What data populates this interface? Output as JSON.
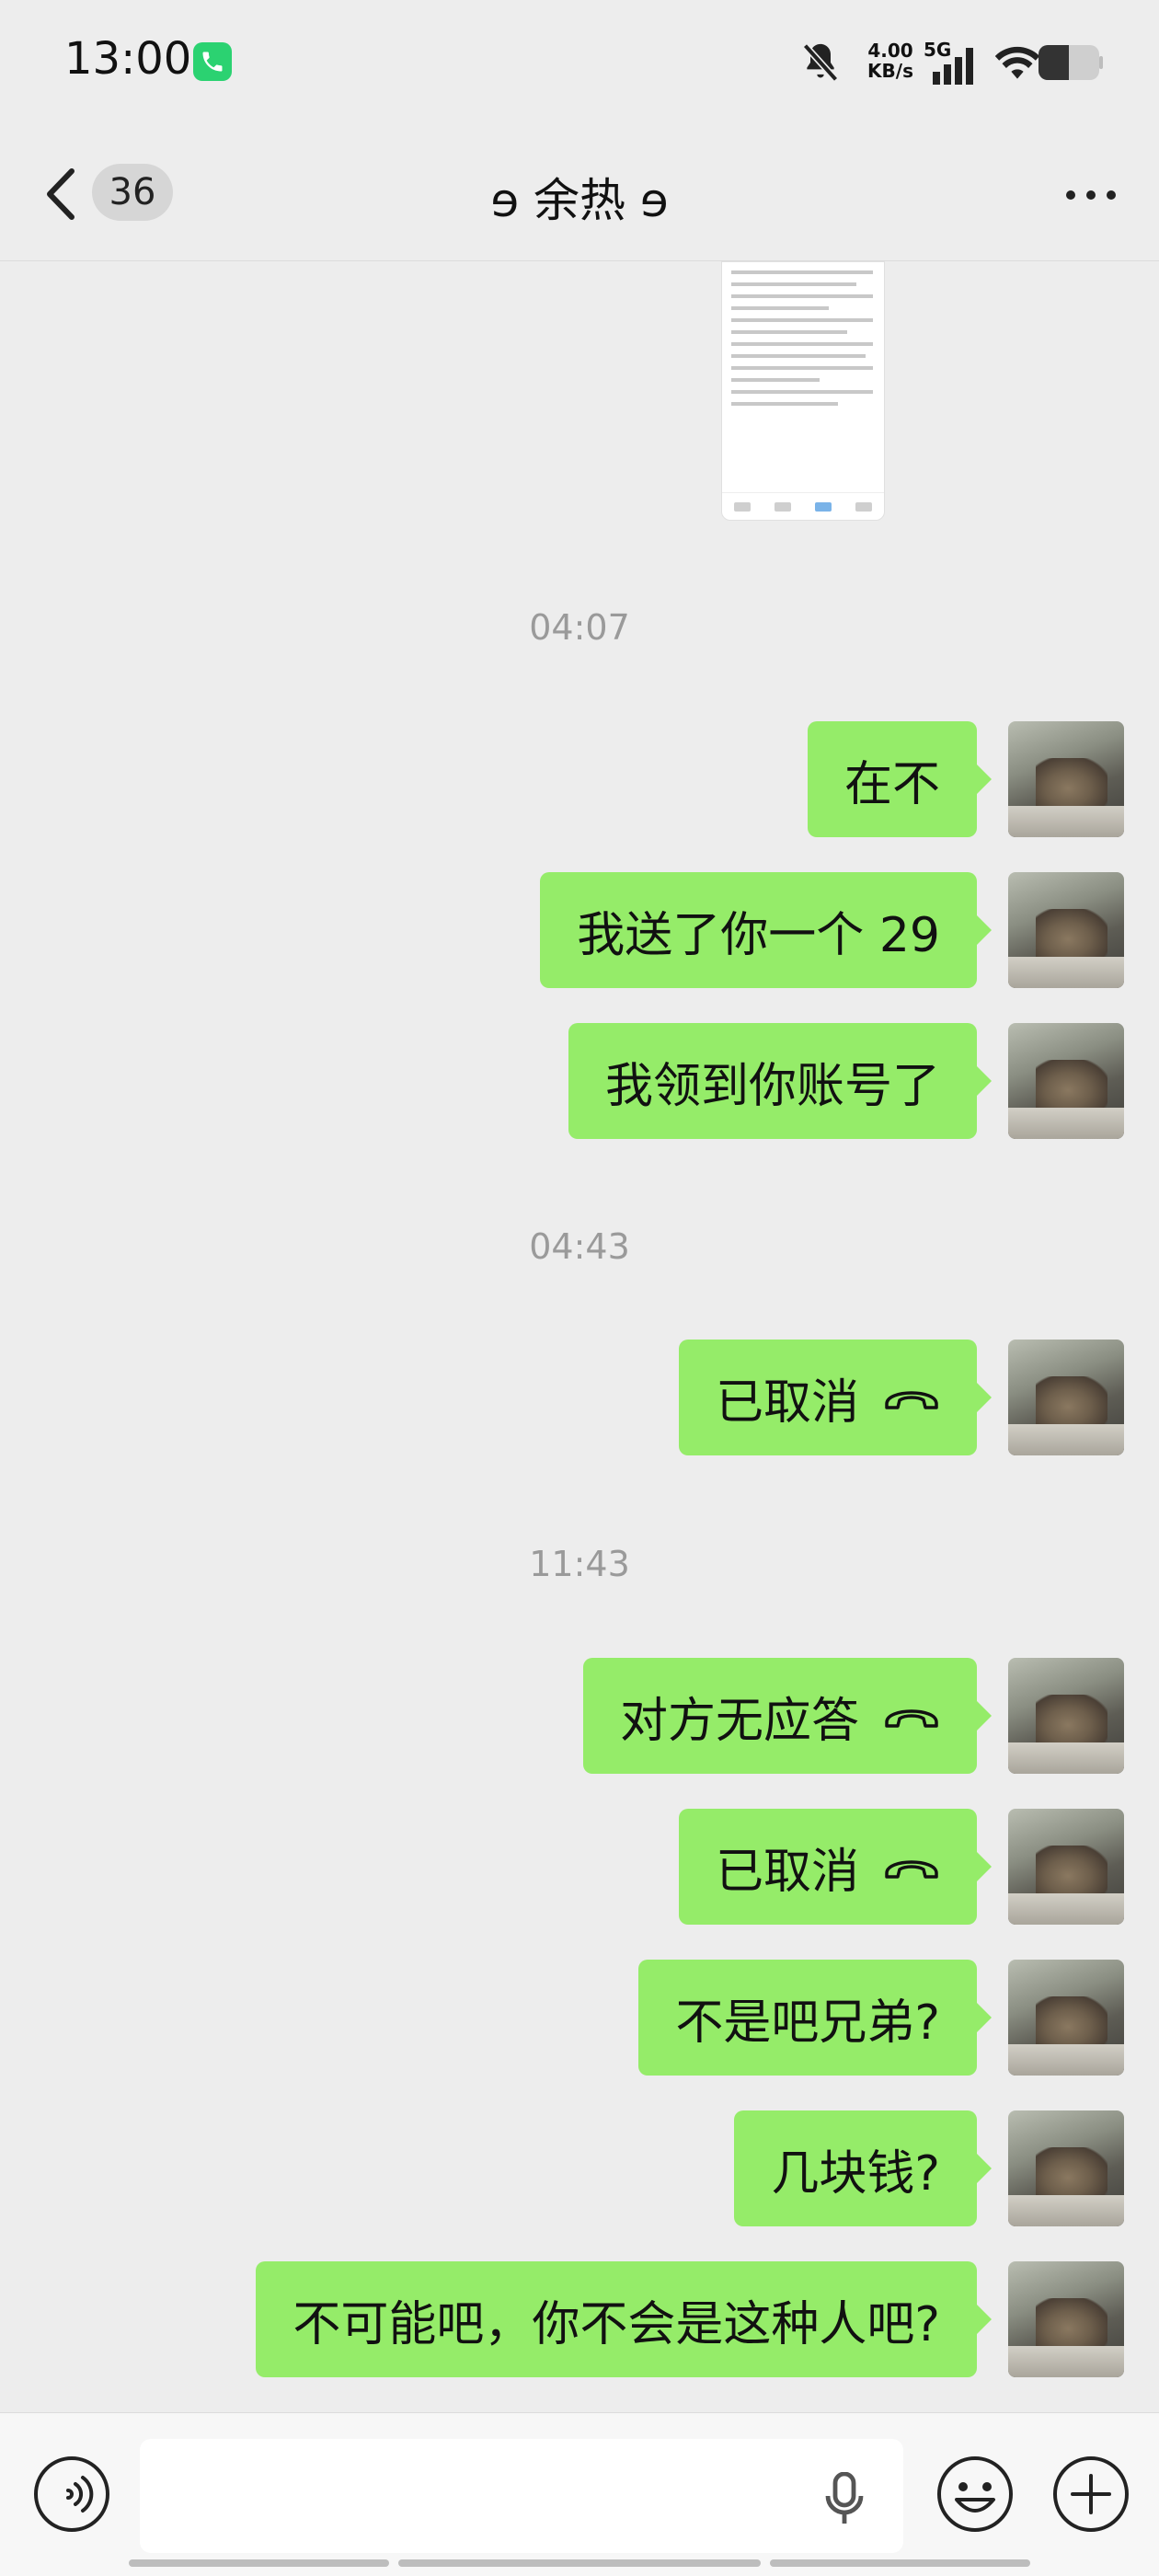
{
  "status_bar": {
    "time": "13:00",
    "net_speed_value": "4.00",
    "net_speed_unit": "KB/s",
    "network": "5G",
    "call_badge_color": "#2bd271"
  },
  "header": {
    "unread_count": "36",
    "title": "ɘ 余热 ɘ"
  },
  "colors": {
    "bubble_self": "#95ec69",
    "background": "#ededed"
  },
  "messages": [
    {
      "type": "time",
      "text": "04:07"
    },
    {
      "type": "text",
      "text": "在不"
    },
    {
      "type": "text",
      "text": "我送了你一个 29"
    },
    {
      "type": "text",
      "text": "我领到你账号了"
    },
    {
      "type": "time",
      "text": "04:43"
    },
    {
      "type": "call",
      "text": "已取消",
      "icon": "hangup-icon"
    },
    {
      "type": "time",
      "text": "11:43"
    },
    {
      "type": "call",
      "text": "对方无应答",
      "icon": "hangup-icon"
    },
    {
      "type": "call",
      "text": "已取消",
      "icon": "hangup-icon"
    },
    {
      "type": "text",
      "text": "不是吧兄弟?"
    },
    {
      "type": "text",
      "text": "几块钱?"
    },
    {
      "type": "text",
      "text": "不可能吧，你不会是这种人吧?"
    }
  ],
  "input": {
    "placeholder": ""
  }
}
